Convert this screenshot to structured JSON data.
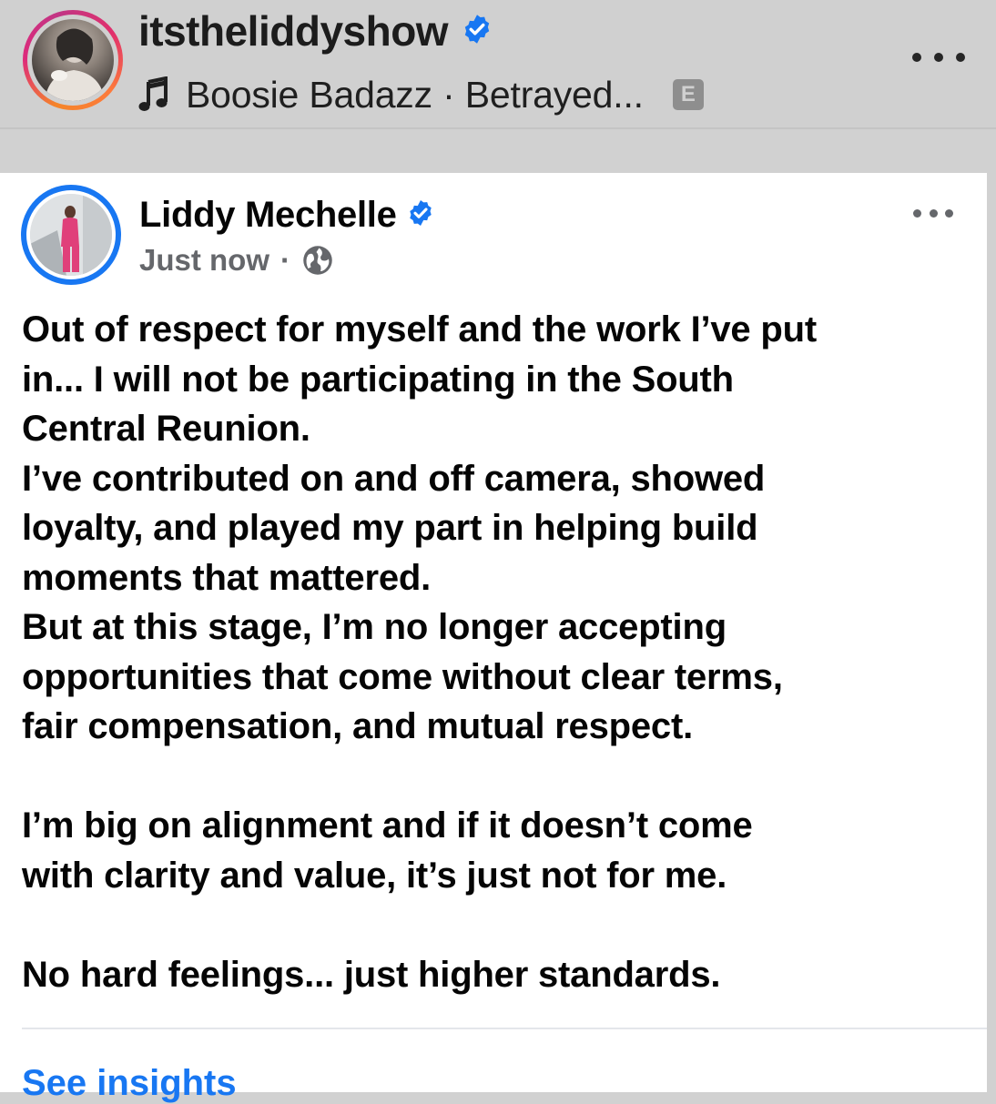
{
  "instagram_header": {
    "username": "itstheliddyshow",
    "music": {
      "artist": "Boosie Badazz",
      "separator": " · ",
      "track": "Betrayed...",
      "explicit_badge": "E"
    },
    "icons": {
      "verified": "verified-badge-icon",
      "music": "music-note-icon",
      "more": "more-options-icon"
    }
  },
  "facebook_post": {
    "author": "Liddy Mechelle",
    "timestamp": "Just now",
    "meta_separator": "·",
    "audience": "public",
    "icons": {
      "verified": "verified-badge-icon",
      "audience": "globe-icon",
      "more": "more-options-icon"
    },
    "body_lines": [
      "Out of respect for myself and the work I’ve put",
      "in... I will not be participating in the South",
      "Central Reunion.",
      "I’ve contributed on and off camera, showed",
      "loyalty, and played my part in helping build",
      "moments that mattered.",
      "But at this stage, I’m no longer accepting",
      "opportunities that come without clear terms,",
      "fair compensation, and mutual respect.",
      "",
      "I’m big on alignment and if it doesn’t come",
      "with clarity and value, it’s just not for me.",
      "",
      "No hard feelings... just higher standards."
    ],
    "footer_link": "See insights"
  },
  "colors": {
    "facebook_blue": "#1877f2",
    "instagram_ring": "#dd2a7b",
    "secondary_text": "#65676b",
    "header_background": "#d0d0d0"
  }
}
